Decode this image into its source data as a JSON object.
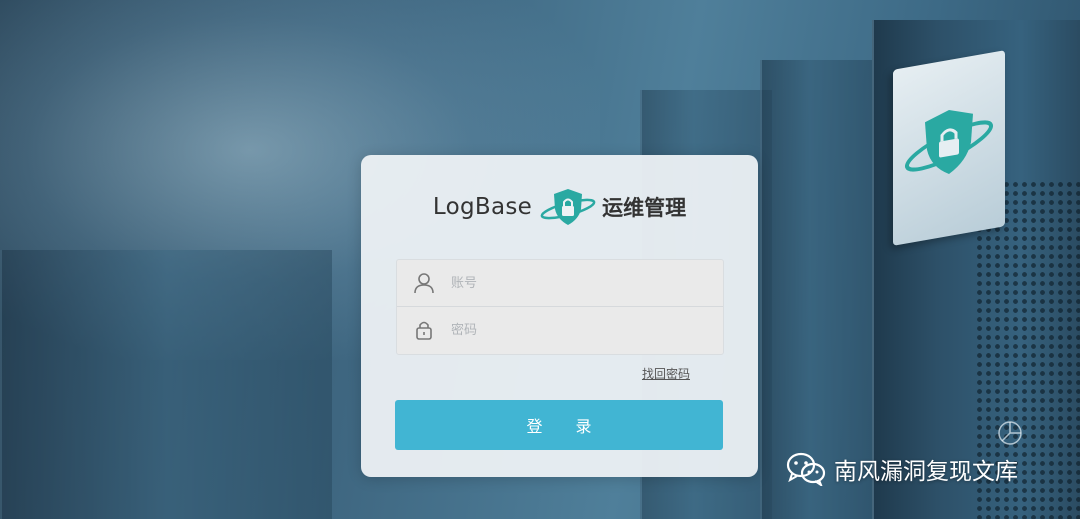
{
  "login": {
    "brand": "LogBase",
    "subtitle": "运维管理",
    "username_placeholder": "账号",
    "password_placeholder": "密码",
    "forgot_password": "找回密码",
    "submit_label": "登 录"
  },
  "watermark": {
    "text": "南风漏洞复现文库",
    "icon": "wechat-icon"
  },
  "colors": {
    "accent": "#41b5d3",
    "shield": "#2aa9a2"
  }
}
